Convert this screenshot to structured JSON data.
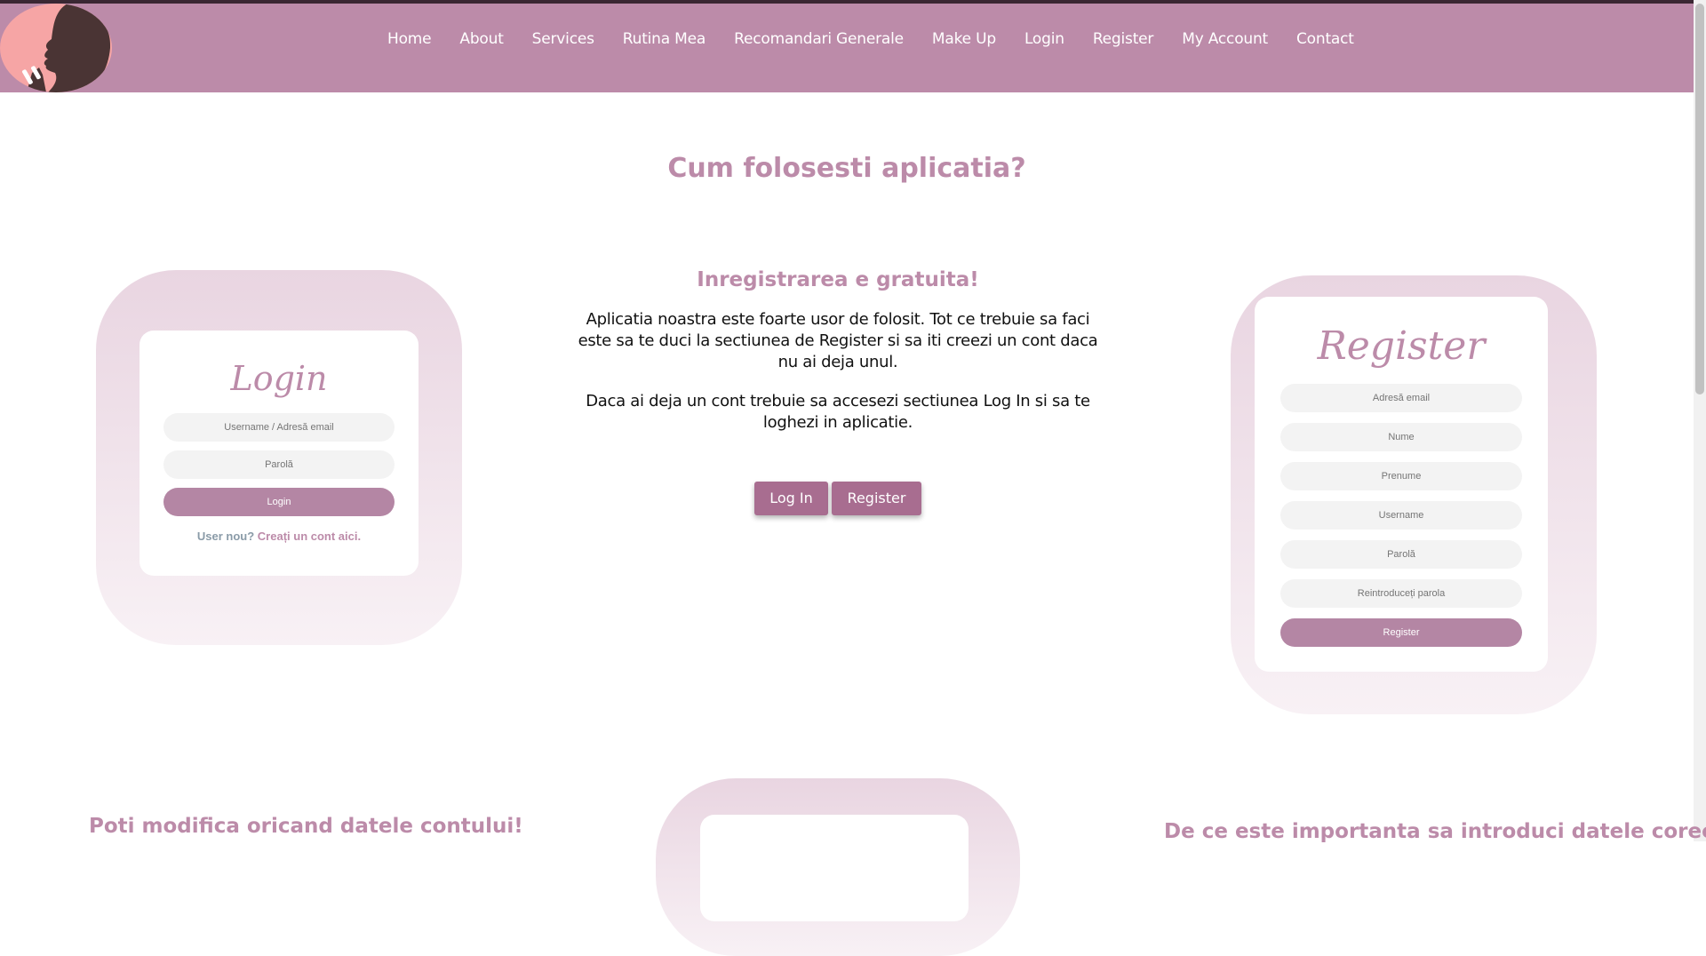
{
  "nav": {
    "items": [
      "Home",
      "About",
      "Services",
      "Rutina Mea",
      "Recomandari Generale",
      "Make Up",
      "Login",
      "Register",
      "My Account",
      "Contact"
    ]
  },
  "main": {
    "title": "Cum folosesti aplicatia?",
    "subtitle": "Inregistrarea e gratuita!",
    "paragraph1": "Aplicatia noastra este foarte usor de folosit. Tot ce trebuie sa faci este sa te duci la sectiunea de Register si sa iti creezi un cont daca nu ai deja unul.",
    "paragraph2": "Daca ai deja un cont trebuie sa accesezi sectiunea Log In si sa te loghezi in aplicatie.",
    "login_button": "Log In",
    "register_button": "Register"
  },
  "login_card": {
    "title": "Login",
    "username_placeholder": "Username / Adresă email",
    "password_placeholder": "Parolă",
    "submit_label": "Login",
    "signup_question": "User nou?",
    "signup_link": "Creați un cont aici."
  },
  "register_card": {
    "title": "Register",
    "email_placeholder": "Adresă email",
    "name_placeholder": "Nume",
    "firstname_placeholder": "Prenume",
    "username_placeholder": "Username",
    "password_placeholder": "Parolă",
    "repeat_password_placeholder": "Reintroduceți parola",
    "submit_label": "Register"
  },
  "bottom": {
    "left_title": "Poti modifica oricand datele contului!",
    "right_title": "De ce este importanta sa introduci datele corect?"
  },
  "colors": {
    "header": "#bc8ba9",
    "accent": "#bc8ba9",
    "button": "#a86d90",
    "logo_bg": "#f6a5a5"
  }
}
